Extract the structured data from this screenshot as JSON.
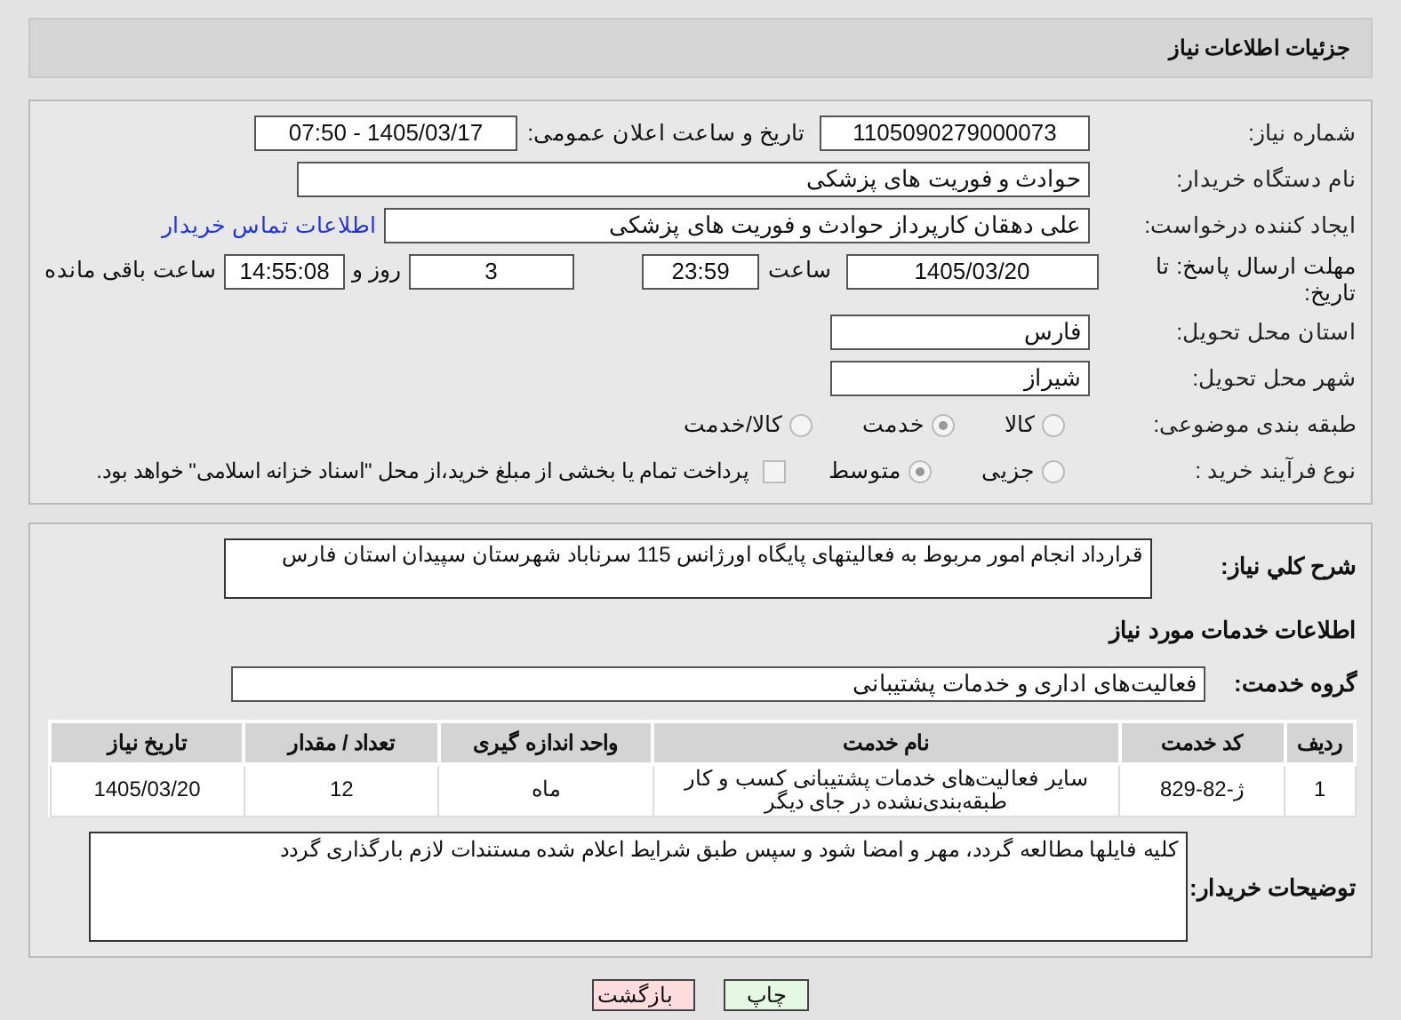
{
  "header": {
    "title": "جزئیات اطلاعات نیاز"
  },
  "details": {
    "need_number": {
      "label": "شماره نیاز:",
      "value": "1105090279000073"
    },
    "announce_date": {
      "label": "تاریخ و ساعت اعلان عمومی:",
      "value": "1405/03/17 - 07:50"
    },
    "buyer_org": {
      "label": "نام دستگاه خریدار:",
      "value": "حوادث و فوریت های پزشکی"
    },
    "requester": {
      "label": "ایجاد کننده درخواست:",
      "value": "علی دهقان کارپرداز حوادث و فوریت های پزشکی",
      "link": "اطلاعات تماس خریدار"
    },
    "deadline": {
      "label": "مهلت ارسال پاسخ: تا تاریخ:",
      "date": "1405/03/20",
      "time_label": "ساعت",
      "time": "23:59",
      "days": "3",
      "days_label": "روز و",
      "remaining": "14:55:08",
      "remaining_label": "ساعت باقی مانده"
    },
    "province": {
      "label": "استان محل تحویل:",
      "value": "فارس"
    },
    "city": {
      "label": "شهر محل تحویل:",
      "value": "شیراز"
    },
    "category": {
      "label": "طبقه بندی موضوعی:",
      "options": [
        {
          "label": "کالا",
          "selected": false
        },
        {
          "label": "خدمت",
          "selected": true
        },
        {
          "label": "کالا/خدمت",
          "selected": false
        }
      ]
    },
    "process": {
      "label": "نوع فرآیند خرید :",
      "options": [
        {
          "label": "جزیی",
          "selected": false
        },
        {
          "label": "متوسط",
          "selected": true
        }
      ],
      "payment": {
        "label": "پرداخت تمام یا بخشی از مبلغ خرید،از محل \"اسناد خزانه اسلامی\" خواهد بود.",
        "checked": false
      }
    }
  },
  "services": {
    "description": {
      "label": "شرح کلي نياز:",
      "value": "قرارداد  انجام امور مربوط به فعالیتهای پایگاه  اورژانس 115 سرناباد  شهرستان سپیدان  استان فارس"
    },
    "section_title": "اطلاعات خدمات مورد نیاز",
    "group": {
      "label": "گروه خدمت:",
      "value": "فعالیت‌های اداری و خدمات پشتیبانی"
    },
    "table": {
      "columns": [
        "ردیف",
        "کد خدمت",
        "نام خدمت",
        "واحد اندازه گیری",
        "تعداد / مقدار",
        "تاریخ نیاز"
      ],
      "rows": [
        [
          "1",
          "ژ-82-829",
          "سایر فعالیت‌های خدمات پشتیبانی کسب و کار طبقه‌بندی‌نشده در جای دیگر",
          "ماه",
          "12",
          "1405/03/20"
        ]
      ]
    },
    "notes": {
      "label": "توضیحات خریدار:",
      "value": "کلیه فایلها مطالعه گردد، مهر و امضا شود و سپس طبق شرایط اعلام شده مستندات لازم بارگذاری گردد"
    }
  },
  "buttons": [
    {
      "label": "چاپ",
      "kind": "print"
    },
    {
      "label": "بازگشت",
      "kind": "back"
    }
  ]
}
